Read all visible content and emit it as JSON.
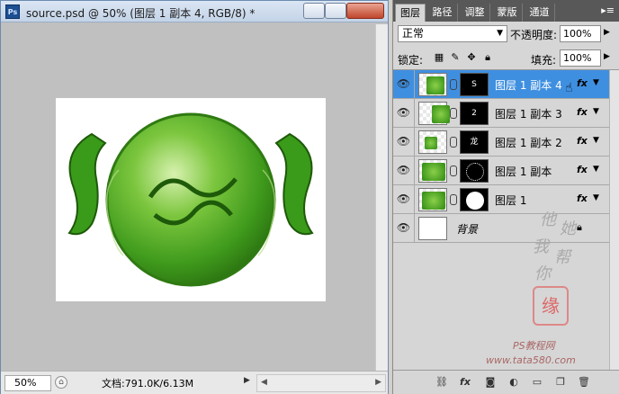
{
  "document": {
    "title": "source.psd @ 50% (图层 1 副本 4, RGB/8) *",
    "zoom": "50%",
    "doc_info": "文档:791.0K/6.13M"
  },
  "panel": {
    "tabs": [
      "图层",
      "路径",
      "调整",
      "蒙版",
      "通道"
    ],
    "active_tab": 0,
    "blend_mode": "正常",
    "opacity_label": "不透明度:",
    "opacity_value": "100%",
    "lock_label": "锁定:",
    "fill_label": "填充:",
    "fill_value": "100%",
    "layers": [
      {
        "name": "图层 1 副本 4",
        "selected": true,
        "fx": "fx",
        "mask_glyph": "S"
      },
      {
        "name": "图层 1 副本 3",
        "selected": false,
        "fx": "fx",
        "mask_glyph": "2"
      },
      {
        "name": "图层 1 副本 2",
        "selected": false,
        "fx": "fx",
        "mask_glyph": "龙"
      },
      {
        "name": "图层 1 副本",
        "selected": false,
        "fx": "fx",
        "mask_glyph": ""
      },
      {
        "name": "图层 1",
        "selected": false,
        "fx": "fx",
        "mask_glyph": ""
      },
      {
        "name": "背景",
        "selected": false,
        "fx": "",
        "mask_glyph": ""
      }
    ]
  },
  "watermark": {
    "chars": [
      "他",
      "她",
      "我",
      "帮",
      "你"
    ],
    "seal": "缘",
    "site_cn": "PS教程网",
    "site_url": "www.tata580.com"
  },
  "colors": {
    "selection": "#3f8fe0",
    "canvas_bg": "#c0c0c0",
    "panel_bg": "#d6d6d6"
  }
}
